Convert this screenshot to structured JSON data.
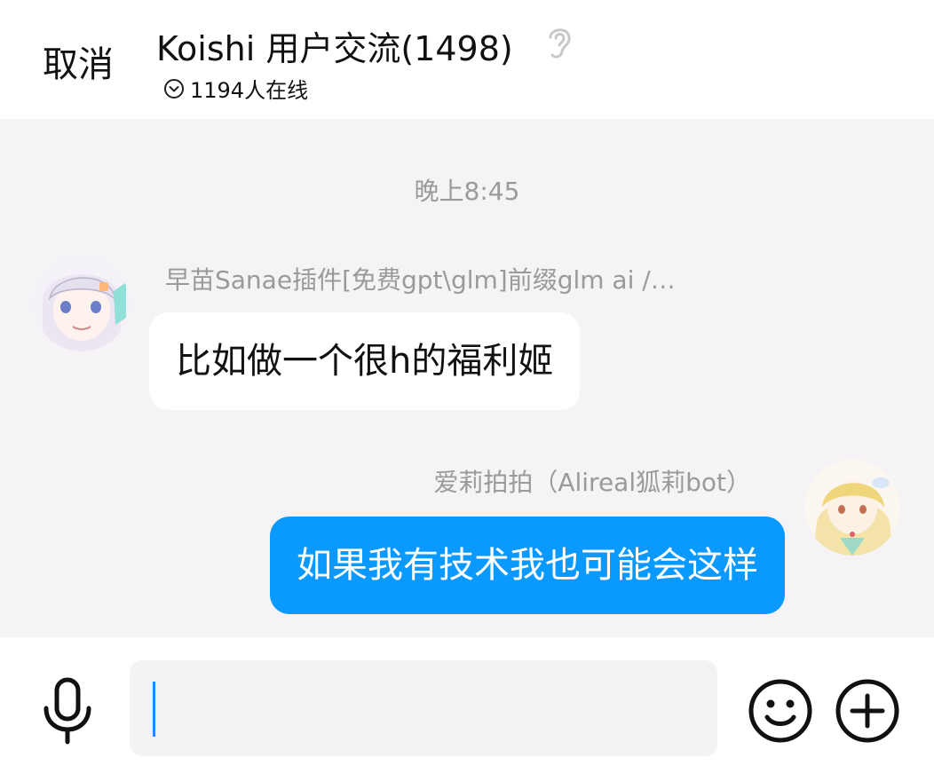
{
  "header": {
    "cancel_label": "取消",
    "title": "Koishi 用户交流(1498)",
    "online_text": "1194人在线",
    "ear_icon": "ear-icon",
    "chevron_icon": "chevron-down-circle-icon"
  },
  "chat": {
    "timestamp": "晚上8:45",
    "messages": [
      {
        "side": "left",
        "sender": "早苗Sanae插件[免费gpt\\glm]前缀glm ai /…",
        "text": "比如做一个很h的福利姬",
        "avatar_icon": "avatar-anime-girl-white-hair"
      },
      {
        "side": "right",
        "sender": "爱莉拍拍（Alireal狐莉bot）",
        "text": "如果我有技术我也可能会这样",
        "avatar_icon": "avatar-anime-girl-blonde"
      }
    ]
  },
  "input_bar": {
    "value": "",
    "mic_icon": "microphone-icon",
    "emoji_icon": "smiley-icon",
    "plus_icon": "plus-circle-icon"
  },
  "colors": {
    "chat_bg": "#f5f3f6",
    "outgoing_bubble": "#0a99ff",
    "incoming_bubble": "#ffffff",
    "meta_text": "#9a9a9a",
    "caret": "#1a8cff"
  }
}
